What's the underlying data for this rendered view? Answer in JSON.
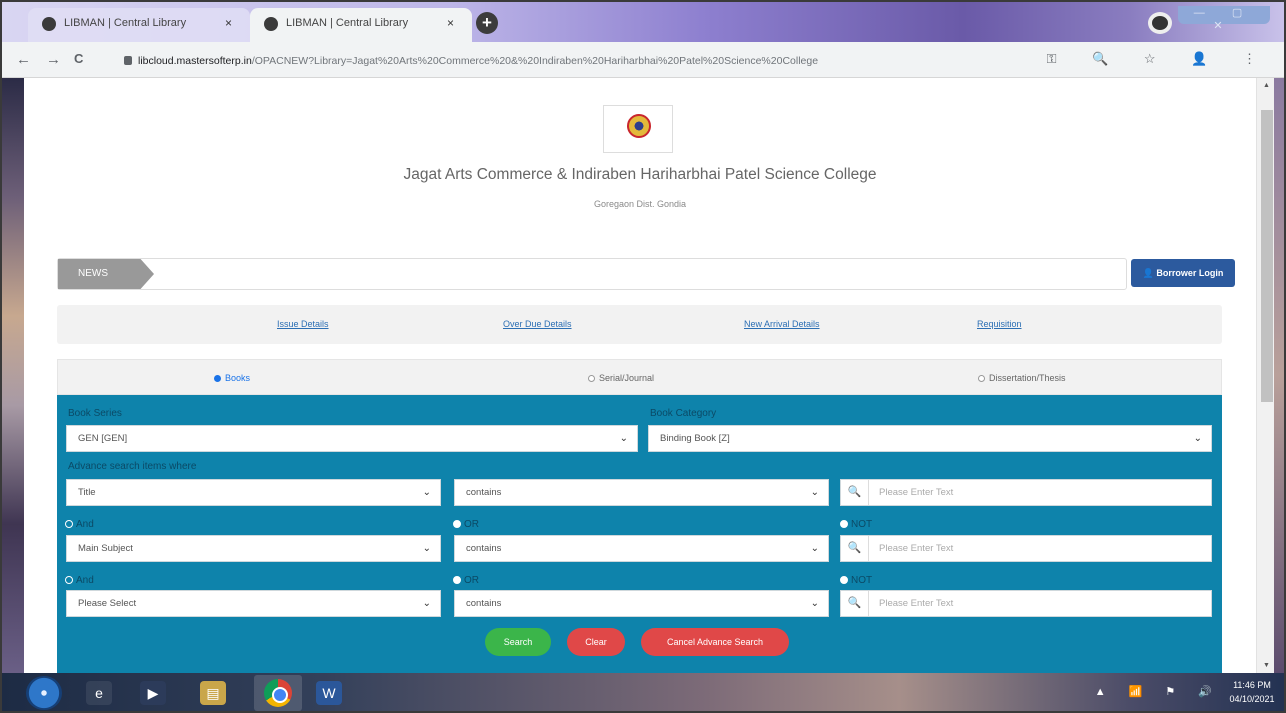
{
  "browser": {
    "tabs": [
      {
        "title": "LIBMAN | Central Library",
        "active": false
      },
      {
        "title": "LIBMAN | Central Library",
        "active": true
      }
    ],
    "new_tab_symbol": "+",
    "close_symbol": "×",
    "window_controls": "— ▢ ✕",
    "url_host": "libcloud.mastersofterp.in",
    "url_path": "/OPACNEW?Library=Jagat%20Arts%20Commerce%20&%20Indiraben%20Hariharbhai%20Patel%20Science%20College",
    "nav": {
      "back": "←",
      "forward": "→",
      "reload": "C"
    },
    "omnibox_icons": "⚿ 🔍 ☆ 👤 ⋮"
  },
  "header": {
    "college_name": "Jagat Arts Commerce & Indiraben Hariharbhai Patel Science College",
    "college_address": "Goregaon Dist. Gondia"
  },
  "news": {
    "label": "NEWS"
  },
  "borrower_login": "Borrower Login",
  "links": [
    "Issue Details",
    "Over Due Details",
    "New Arrival Details",
    "Requisition"
  ],
  "material_types": [
    {
      "label": "Books",
      "selected": true
    },
    {
      "label": "Serial/Journal",
      "selected": false
    },
    {
      "label": "Dissertation/Thesis",
      "selected": false
    }
  ],
  "search": {
    "book_series_label": "Book Series",
    "book_series_value": "GEN [GEN]",
    "book_category_label": "Book Category",
    "book_category_value": "Binding Book [Z]",
    "advance_label": "Advance search items where",
    "rows": [
      {
        "field": "Title",
        "operator": "contains",
        "placeholder": "Please Enter Text"
      },
      {
        "field": "Main Subject",
        "operator": "contains",
        "placeholder": "Please Enter Text"
      },
      {
        "field": "Please Select",
        "operator": "contains",
        "placeholder": "Please Enter Text"
      }
    ],
    "logic_rows": [
      {
        "and": "And",
        "or": "OR",
        "not": "NOT"
      },
      {
        "and": "And",
        "or": "OR",
        "not": "NOT"
      }
    ],
    "buttons": {
      "search": "Search",
      "clear": "Clear",
      "cancel": "Cancel Advance Search"
    }
  },
  "taskbar": {
    "clock_time": "11:46 PM",
    "clock_date": "04/10/2021",
    "tray_icons": "▲ 📶 ⚑ 🔊"
  },
  "colors": {
    "panel_blue": "#0e83ab",
    "login_blue": "#2c5a9e",
    "search_green": "#3bb54a",
    "clear_red": "#e04848"
  }
}
